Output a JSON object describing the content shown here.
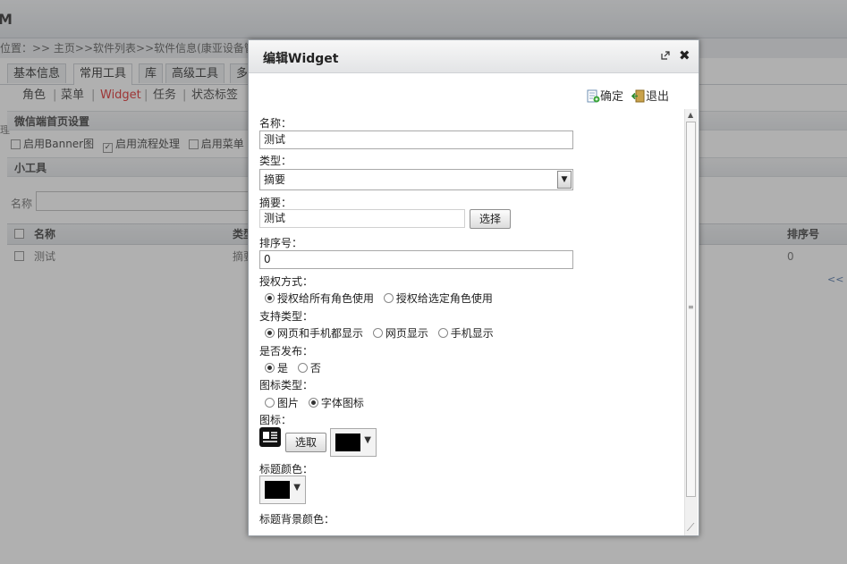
{
  "app": {
    "title": "M"
  },
  "breadcrumb": "位置：>> 主页>>软件列表>>软件信息(康亚设备管理",
  "tabs": [
    "基本信息",
    "常用工具",
    "库",
    "高级工具",
    "多"
  ],
  "subnav": [
    "角色",
    "菜单",
    "Widget",
    "任务",
    "状态标签"
  ],
  "left_edge": "理",
  "section_wechat": "微信端首页设置",
  "options": [
    "启用Banner图",
    "启用流程处理",
    "启用菜单"
  ],
  "section_tools": "小工具",
  "filter_label": "名称",
  "grid": {
    "headers": [
      "名称",
      "类型",
      "排序号"
    ],
    "row": {
      "name": "测试",
      "type": "摘要",
      "order": "0"
    },
    "pager": "<<"
  },
  "dialog": {
    "title": "编辑Widget",
    "confirm": "确定",
    "exit": "退出",
    "name_label": "名称：",
    "name_value": "测试",
    "type_label": "类型：",
    "type_value": "摘要",
    "summary_label": "摘要：",
    "summary_value": "测试",
    "select_button": "选择",
    "order_label": "排序号：",
    "order_value": "0",
    "auth_label": "授权方式：",
    "auth_options": [
      "授权给所有角色使用",
      "授权给选定角色使用"
    ],
    "support_label": "支持类型：",
    "support_options": [
      "网页和手机都显示",
      "网页显示",
      "手机显示"
    ],
    "publish_label": "是否发布：",
    "publish_options": [
      "是",
      "否"
    ],
    "icon_type_label": "图标类型：",
    "icon_type_options": [
      "图片",
      "字体图标"
    ],
    "icon_label": "图标：",
    "pick_button": "选取",
    "title_color_label": "标题颜色：",
    "title_bg_label": "标题背景颜色："
  },
  "colors": {
    "accent_red": "#dd2222",
    "swatch": "#000000"
  }
}
